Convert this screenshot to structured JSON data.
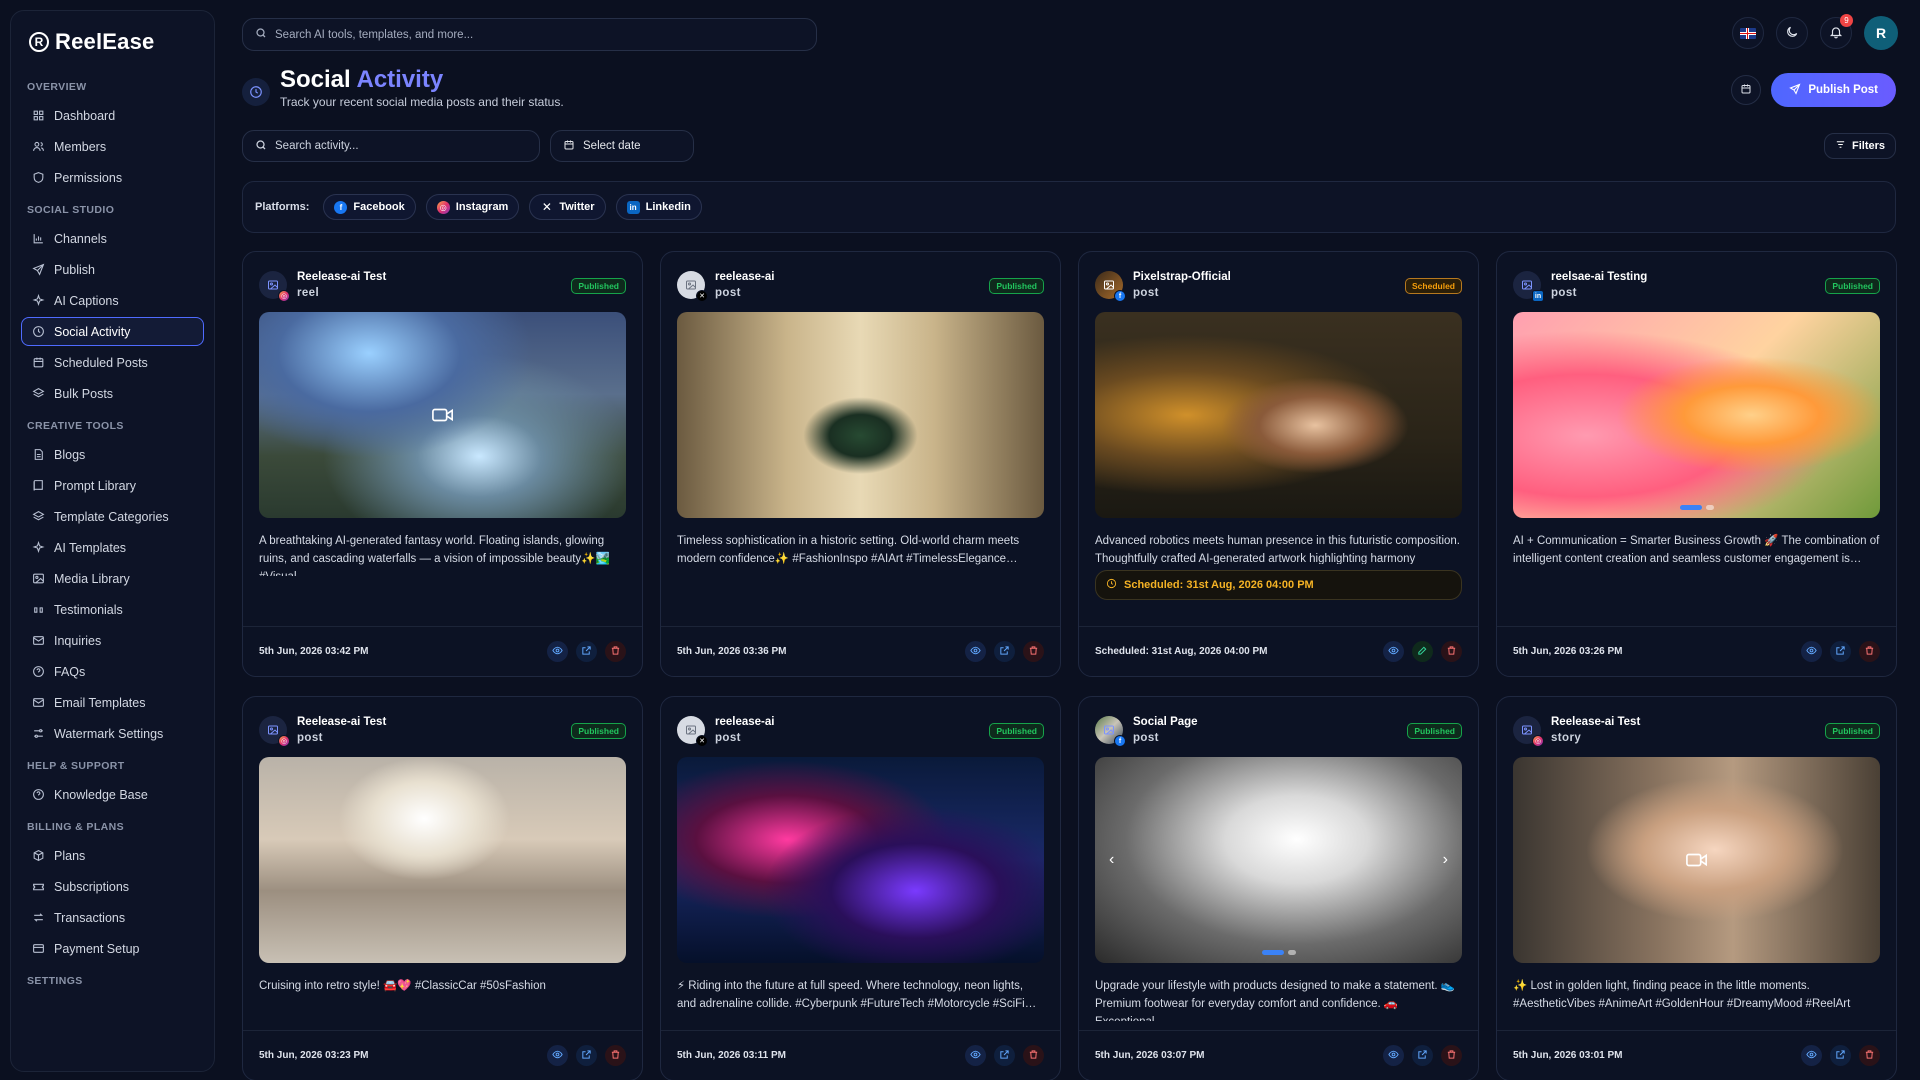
{
  "app": {
    "name": "ReelEase",
    "logo_letter": "R"
  },
  "topbar": {
    "search_placeholder": "Search AI tools, templates, and more...",
    "notification_count": "9",
    "avatar_letter": "R"
  },
  "sidebar": {
    "sections": [
      {
        "title": "OVERVIEW",
        "items": [
          {
            "label": "Dashboard",
            "icon": "grid-icon"
          },
          {
            "label": "Members",
            "icon": "users-icon"
          },
          {
            "label": "Permissions",
            "icon": "shield-icon"
          }
        ]
      },
      {
        "title": "SOCIAL STUDIO",
        "items": [
          {
            "label": "Channels",
            "icon": "chart-icon"
          },
          {
            "label": "Publish",
            "icon": "send-icon"
          },
          {
            "label": "AI Captions",
            "icon": "sparkle-icon"
          },
          {
            "label": "Social Activity",
            "icon": "clock-icon",
            "active": true
          },
          {
            "label": "Scheduled Posts",
            "icon": "calendar-icon"
          },
          {
            "label": "Bulk Posts",
            "icon": "layers-icon"
          }
        ]
      },
      {
        "title": "CREATIVE TOOLS",
        "items": [
          {
            "label": "Blogs",
            "icon": "file-icon"
          },
          {
            "label": "Prompt Library",
            "icon": "book-icon"
          },
          {
            "label": "Template Categories",
            "icon": "layers-icon"
          },
          {
            "label": "AI Templates",
            "icon": "sparkle-icon"
          },
          {
            "label": "Media Library",
            "icon": "image-icon"
          },
          {
            "label": "Testimonials",
            "icon": "quote-icon"
          },
          {
            "label": "Inquiries",
            "icon": "mail-icon"
          },
          {
            "label": "FAQs",
            "icon": "help-icon"
          },
          {
            "label": "Email Templates",
            "icon": "mail-icon"
          },
          {
            "label": "Watermark Settings",
            "icon": "sliders-icon"
          }
        ]
      },
      {
        "title": "HELP & SUPPORT",
        "items": [
          {
            "label": "Knowledge Base",
            "icon": "help-icon"
          }
        ]
      },
      {
        "title": "BILLING & PLANS",
        "items": [
          {
            "label": "Plans",
            "icon": "box-icon"
          },
          {
            "label": "Subscriptions",
            "icon": "ticket-icon"
          },
          {
            "label": "Transactions",
            "icon": "swap-icon"
          },
          {
            "label": "Payment Setup",
            "icon": "card-icon"
          }
        ]
      },
      {
        "title": "SETTINGS",
        "items": []
      }
    ]
  },
  "header": {
    "title_main": "Social",
    "title_accent": "Activity",
    "subtitle": "Track your recent social media posts and their status.",
    "publish_label": "Publish Post"
  },
  "filters": {
    "search_placeholder": "Search activity...",
    "date_label": "Select date",
    "filters_label": "Filters"
  },
  "platforms": {
    "label": "Platforms:",
    "items": [
      {
        "label": "Facebook",
        "icon": "facebook-icon"
      },
      {
        "label": "Instagram",
        "icon": "instagram-icon"
      },
      {
        "label": "Twitter",
        "icon": "x-icon"
      },
      {
        "label": "Linkedin",
        "icon": "linkedin-icon"
      }
    ]
  },
  "posts": [
    {
      "account": "Reelease-ai Test",
      "type": "reel",
      "status": "Published",
      "network": "instagram",
      "text": "A breathtaking AI-generated fantasy world. Floating islands, glowing ruins, and cascading waterfalls — a vision of impossible beauty✨🏞️ #Visual…",
      "date": "5th Jun, 2026 03:42 PM",
      "image": "fantasy-landscape",
      "media": "video"
    },
    {
      "account": "reelease-ai",
      "type": "post",
      "status": "Published",
      "network": "x",
      "text": "Timeless sophistication in a historic setting. Old-world charm meets modern confidence✨ #FashionInspo #AIArt #TimelessElegance…",
      "date": "5th Jun, 2026 03:36 PM",
      "image": "palace-gown"
    },
    {
      "account": "Pixelstrap-Official",
      "type": "post",
      "status": "Scheduled",
      "network": "facebook",
      "text": "Advanced robotics meets human presence in this futuristic composition. Thoughtfully crafted AI-generated artwork highlighting harmony between…",
      "scheduled_note": "Scheduled: 31st Aug, 2026 04:00 PM",
      "date": "Scheduled: 31st Aug, 2026 04:00 PM",
      "image": "robot-girl"
    },
    {
      "account": "reelsae-ai Testing",
      "type": "post",
      "status": "Published",
      "network": "linkedin",
      "text": "AI + Communication = Smarter Business Growth 🚀 The combination of intelligent content creation and seamless customer engagement is…",
      "date": "5th Jun, 2026 03:26 PM",
      "image": "phone-apps",
      "media": "carousel"
    },
    {
      "account": "Reelease-ai Test",
      "type": "post",
      "status": "Published",
      "network": "instagram",
      "text": "Cruising into retro style! 🚘💖 #ClassicCar #50sFashion",
      "date": "5th Jun, 2026 03:23 PM",
      "image": "retro-car"
    },
    {
      "account": "reelease-ai",
      "type": "post",
      "status": "Published",
      "network": "x",
      "text": "⚡ Riding into the future at full speed. Where technology, neon lights, and adrenaline collide. #Cyberpunk #FutureTech #Motorcycle #SciFi…",
      "date": "5th Jun, 2026 03:11 PM",
      "image": "cyber-bike"
    },
    {
      "account": "Social Page",
      "type": "post",
      "status": "Published",
      "network": "facebook",
      "text": "Upgrade your lifestyle with products designed to make a statement. 👟 Premium footwear for everyday comfort and confidence. 🚗 Exceptional…",
      "date": "5th Jun, 2026 03:07 PM",
      "image": "sneakers",
      "media": "carousel"
    },
    {
      "account": "Reelease-ai Test",
      "type": "story",
      "status": "Published",
      "network": "instagram",
      "text": "✨ Lost in golden light, finding peace in the little moments. #AestheticVibes #AnimeArt #GoldenHour #DreamyMood #ReelArt",
      "date": "5th Jun, 2026 03:01 PM",
      "image": "anime-girl",
      "media": "video"
    }
  ]
}
